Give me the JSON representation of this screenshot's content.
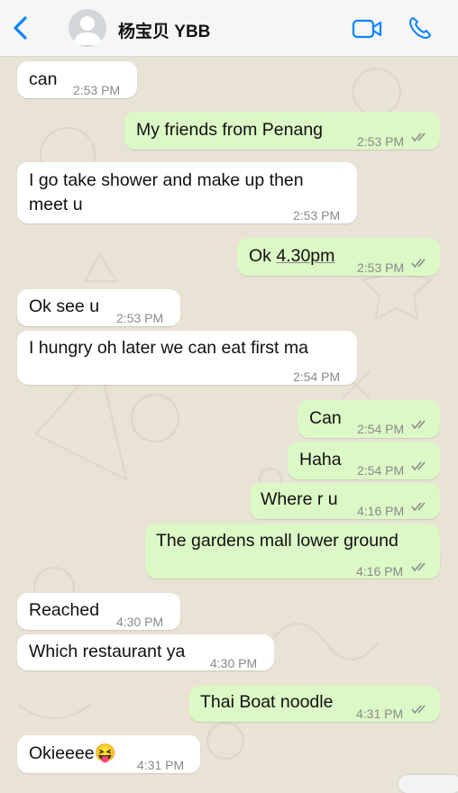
{
  "header": {
    "contact_name": "杨宝贝 YBB"
  },
  "messages": [
    {
      "dir": "in",
      "text": "can",
      "time": "2:53 PM"
    },
    {
      "dir": "out",
      "text": "My friends from Penang",
      "time": "2:53 PM"
    },
    {
      "dir": "in",
      "text": "I go take shower and make up then",
      "text2": "meet u",
      "time": "2:53 PM"
    },
    {
      "dir": "out",
      "text": "Ok ",
      "text_link": "4.30pm",
      "time": "2:53 PM"
    },
    {
      "dir": "in",
      "text": "Ok see u",
      "time": "2:53 PM"
    },
    {
      "dir": "in",
      "text": "I hungry oh later we can eat first ma",
      "time": "2:54 PM"
    },
    {
      "dir": "out",
      "text": "Can",
      "time": "2:54 PM"
    },
    {
      "dir": "out",
      "text": "Haha",
      "time": "2:54 PM"
    },
    {
      "dir": "out",
      "text": "Where r u",
      "time": "4:16 PM"
    },
    {
      "dir": "out",
      "text": "The gardens mall lower ground",
      "time": "4:16 PM"
    },
    {
      "dir": "in",
      "text": "Reached",
      "time": "4:30 PM"
    },
    {
      "dir": "in",
      "text": "Which restaurant ya",
      "time": "4:30 PM"
    },
    {
      "dir": "out",
      "text": "Thai Boat noodle",
      "time": "4:31 PM"
    },
    {
      "dir": "in",
      "text": "Okieeee",
      "emoji": "😝",
      "time": "4:31 PM"
    }
  ],
  "colors": {
    "accent": "#0a84ff",
    "outgoing_bubble": "#dcf8c6",
    "incoming_bubble": "#ffffff",
    "read_ticks": "#8a8a8a"
  }
}
